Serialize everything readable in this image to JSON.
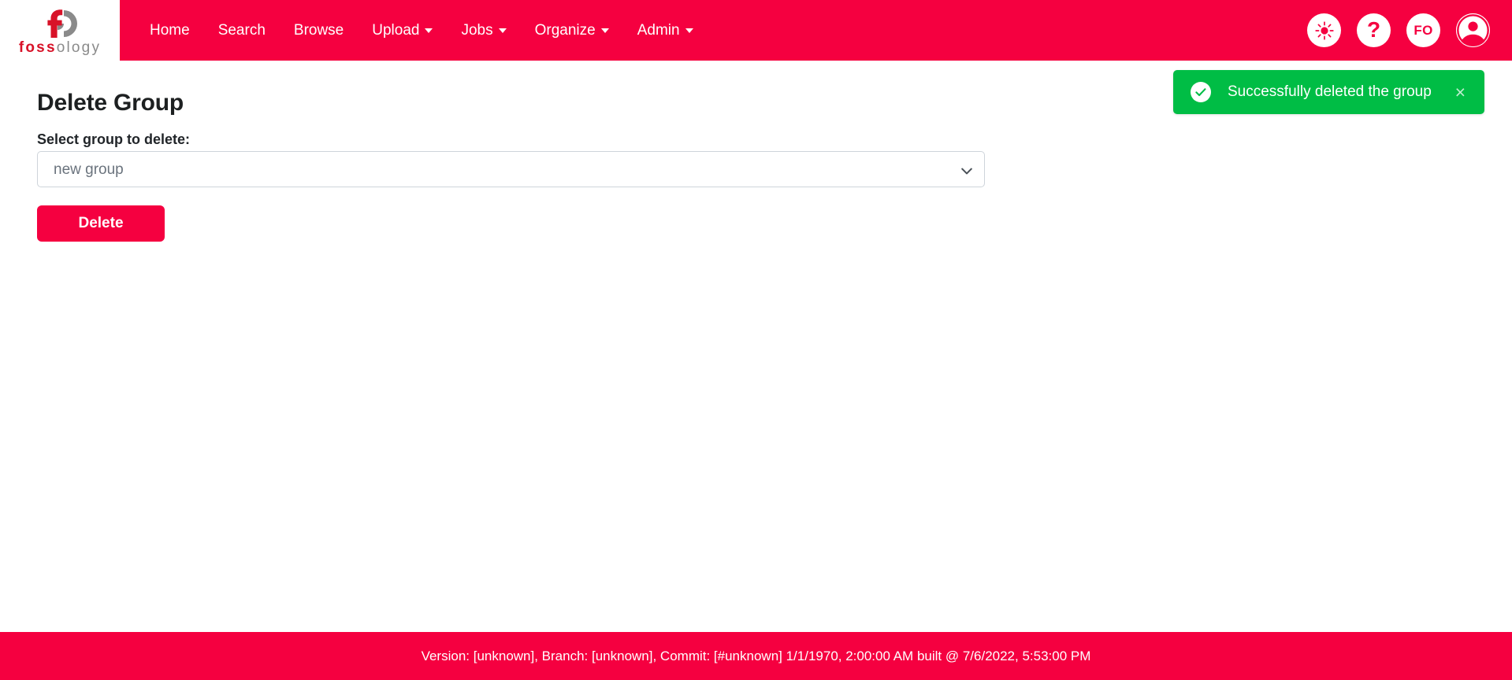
{
  "brand": {
    "logo_icon": "fossology-logo-icon",
    "name_part1": "foss",
    "name_part2": "ology"
  },
  "navbar": {
    "background_color": "#F50040",
    "items": [
      {
        "label": "Home",
        "has_dropdown": false,
        "name": "nav-item-home"
      },
      {
        "label": "Search",
        "has_dropdown": false,
        "name": "nav-item-search"
      },
      {
        "label": "Browse",
        "has_dropdown": false,
        "name": "nav-item-browse"
      },
      {
        "label": "Upload",
        "has_dropdown": true,
        "name": "nav-item-upload"
      },
      {
        "label": "Jobs",
        "has_dropdown": true,
        "name": "nav-item-jobs"
      },
      {
        "label": "Organize",
        "has_dropdown": true,
        "name": "nav-item-organize"
      },
      {
        "label": "Admin",
        "has_dropdown": true,
        "name": "nav-item-admin"
      }
    ],
    "actions": {
      "theme_toggle_icon": "sun-icon",
      "help_icon": "question-mark-icon",
      "help_glyph": "?",
      "group_badge_label": "FO",
      "group_badge_icon": "group-badge-icon",
      "user_icon": "user-avatar-icon"
    }
  },
  "toast": {
    "message": "Successfully deleted the group",
    "close_label": "×",
    "status_icon": "check-circle-icon",
    "background_color": "#00BD45",
    "text_color": "#FFFFFF"
  },
  "main": {
    "page_title": "Delete Group",
    "form": {
      "select_label": "Select group to delete:",
      "select_value": "new group",
      "select_options": [
        "new group"
      ],
      "chevron_icon": "chevron-down-icon",
      "submit_label": "Delete"
    }
  },
  "footer": {
    "text": "Version: [unknown], Branch: [unknown], Commit: [#unknown] 1/1/1970, 2:00:00 AM built @ 7/6/2022, 5:53:00 PM",
    "background_color": "#F50040"
  }
}
